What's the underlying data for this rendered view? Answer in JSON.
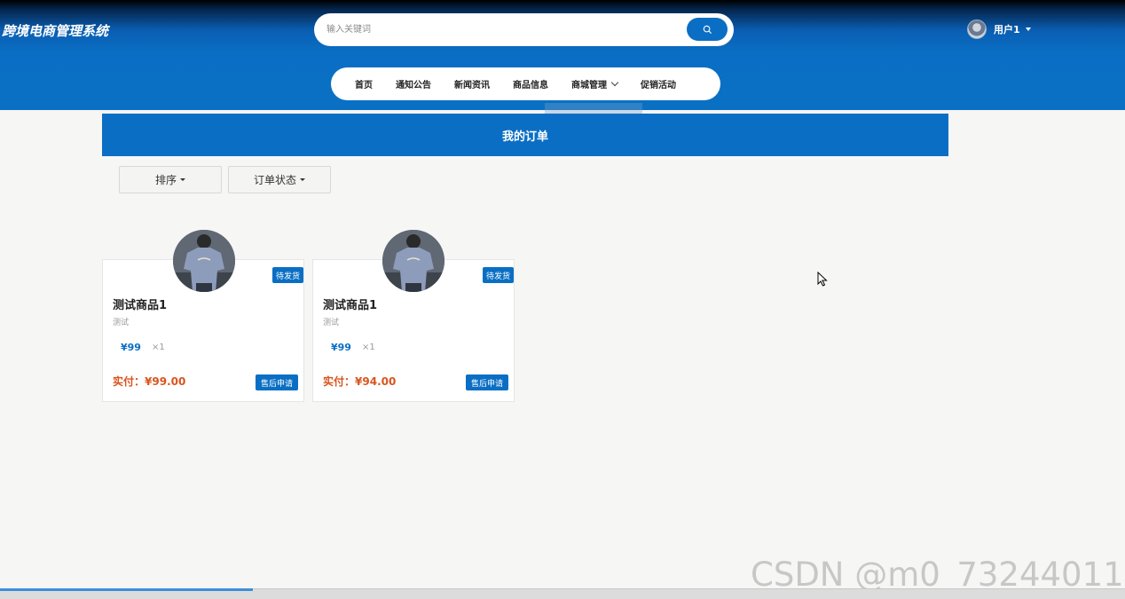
{
  "header": {
    "logo": "跨境电商管理系统",
    "search_placeholder": "输入关键词",
    "user_name": "用户1"
  },
  "nav": {
    "items": [
      {
        "label": "首页"
      },
      {
        "label": "通知公告"
      },
      {
        "label": "新闻资讯"
      },
      {
        "label": "商品信息"
      },
      {
        "label": "商城管理",
        "has_dropdown": true
      },
      {
        "label": "促销活动"
      }
    ]
  },
  "page": {
    "title": "我的订单"
  },
  "filters": {
    "sort_label": "排序",
    "status_label": "订单状态"
  },
  "orders": [
    {
      "status": "待发货",
      "name": "测试商品1",
      "desc": "测试",
      "price": "¥99",
      "qty": "×1",
      "paid_label": "实付：",
      "paid": "¥99.00",
      "aftersale": "售后申请"
    },
    {
      "status": "待发货",
      "name": "测试商品1",
      "desc": "测试",
      "price": "¥99",
      "qty": "×1",
      "paid_label": "实付：",
      "paid": "¥94.00",
      "aftersale": "售后申请"
    }
  ],
  "watermark": "CSDN @m0_73244011",
  "colors": {
    "primary": "#0a6fc4",
    "paid": "#d9541e"
  }
}
